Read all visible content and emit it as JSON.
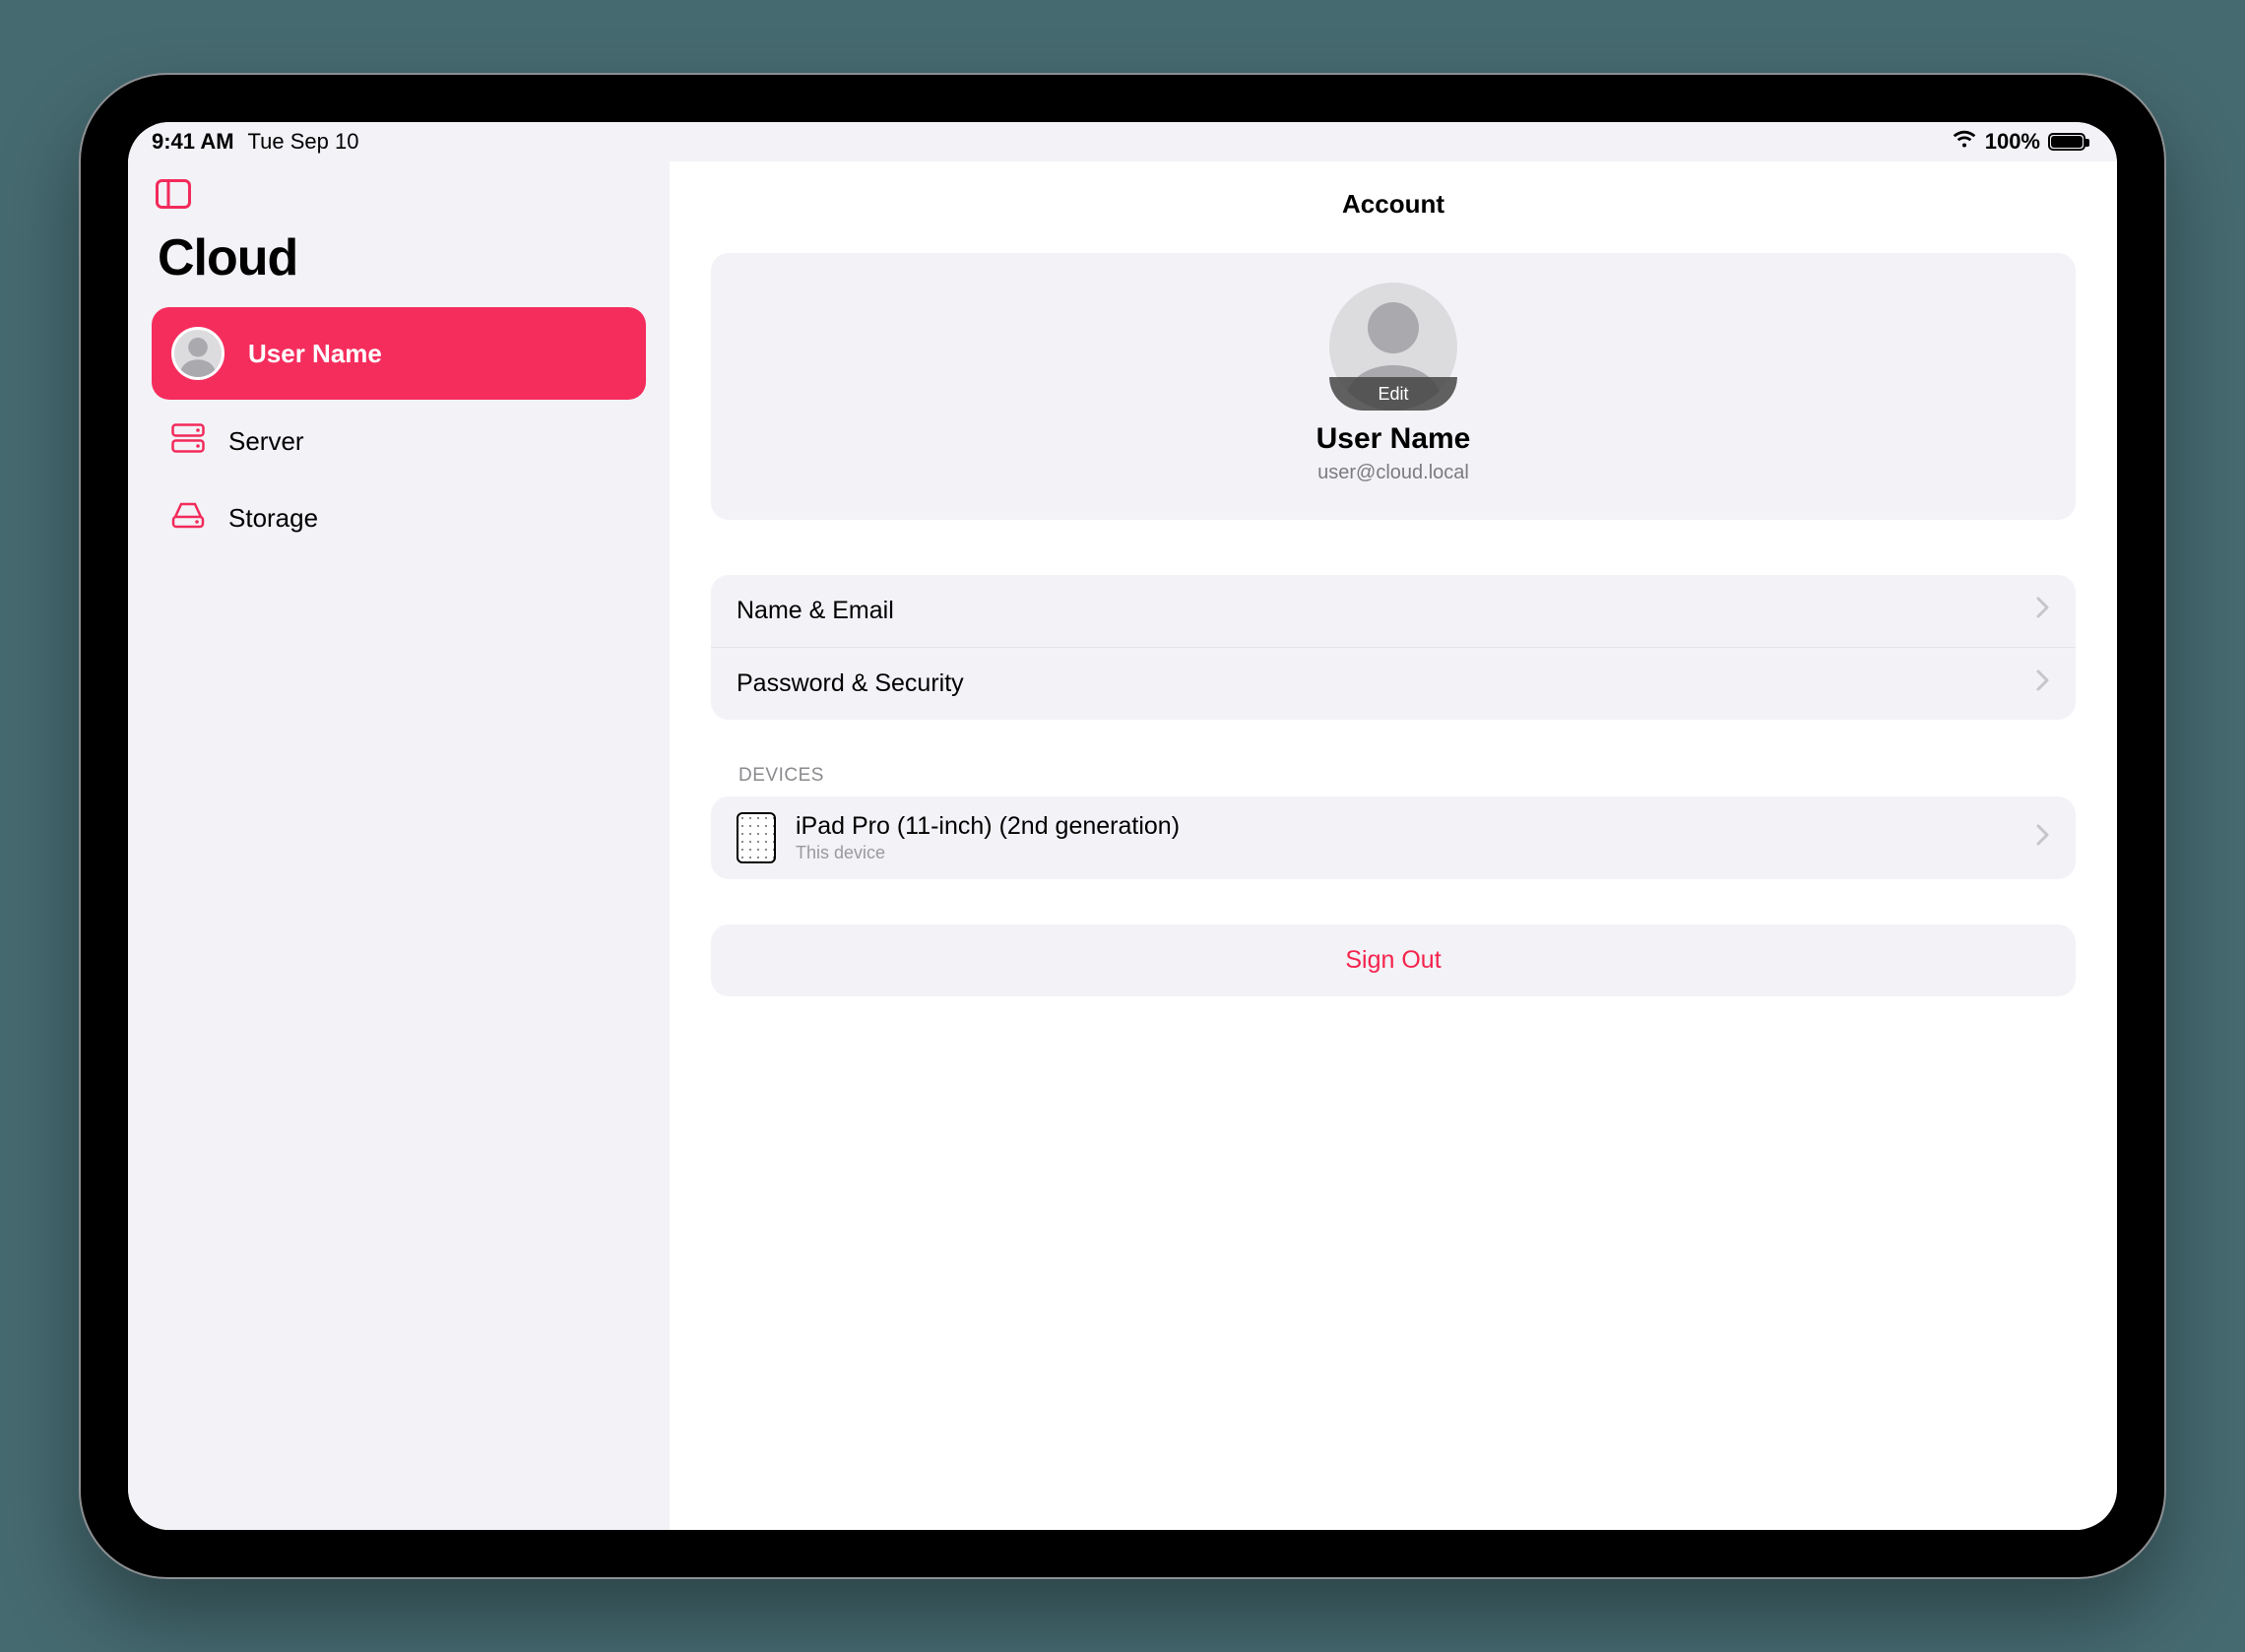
{
  "status": {
    "time": "9:41 AM",
    "date": "Tue Sep 10",
    "battery_pct": "100%"
  },
  "sidebar": {
    "title": "Cloud",
    "items": [
      {
        "label": "User Name",
        "icon": "avatar",
        "selected": true
      },
      {
        "label": "Server",
        "icon": "server",
        "selected": false
      },
      {
        "label": "Storage",
        "icon": "storage",
        "selected": false
      }
    ]
  },
  "detail": {
    "title": "Account",
    "profile": {
      "name": "User Name",
      "email": "user@cloud.local",
      "edit_label": "Edit"
    },
    "account_rows": [
      {
        "label": "Name & Email"
      },
      {
        "label": "Password & Security"
      }
    ],
    "devices_header": "DEVICES",
    "devices": [
      {
        "name": "iPad Pro (11-inch) (2nd generation)",
        "subtitle": "This device"
      }
    ],
    "signout_label": "Sign Out"
  },
  "colors": {
    "accent": "#f52d5d",
    "sidebar_bg": "#f2f2f7",
    "group_bg": "#f2f2f7",
    "muted_text": "#8a8a8e"
  }
}
